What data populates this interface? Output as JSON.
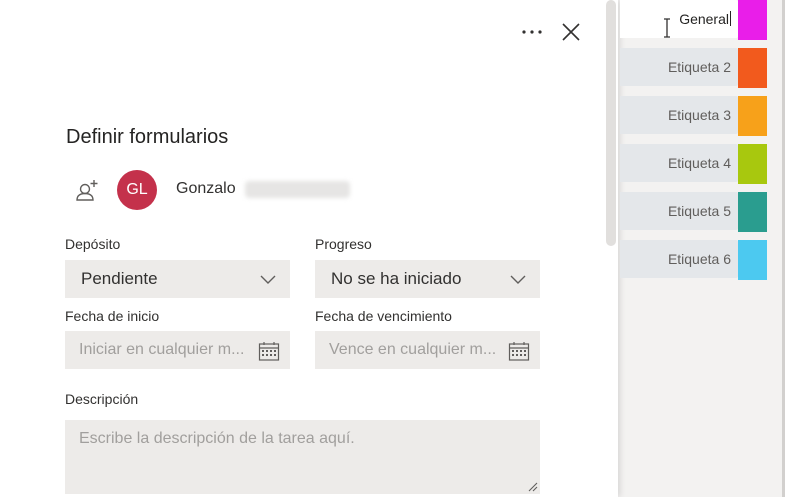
{
  "panel": {
    "title": "Definir formularios",
    "more_icon": "more-horizontal-icon",
    "close_icon": "close-icon"
  },
  "assignee": {
    "assign_icon": "add-person-icon",
    "initials": "GL",
    "first_name": "Gonzalo",
    "avatar_color": "#c4314b"
  },
  "fields": {
    "bucket": {
      "label": "Depósito",
      "value": "Pendiente"
    },
    "progress": {
      "label": "Progreso",
      "value": "No se ha iniciado"
    },
    "start_date": {
      "label": "Fecha de inicio",
      "placeholder": "Iniciar en cualquier m..."
    },
    "due_date": {
      "label": "Fecha de vencimiento",
      "placeholder": "Vence en cualquier m..."
    },
    "description": {
      "label": "Descripción",
      "placeholder": "Escribe la descripción de la tarea aquí."
    }
  },
  "labels": [
    {
      "text": "General",
      "color": "#e91ee9",
      "editing": true
    },
    {
      "text": "Etiqueta 2",
      "color": "#f25a1d"
    },
    {
      "text": "Etiqueta 3",
      "color": "#f7a11a"
    },
    {
      "text": "Etiqueta 4",
      "color": "#a8c80e"
    },
    {
      "text": "Etiqueta 5",
      "color": "#2a9d8f"
    },
    {
      "text": "Etiqueta 6",
      "color": "#4cc9f0"
    }
  ]
}
